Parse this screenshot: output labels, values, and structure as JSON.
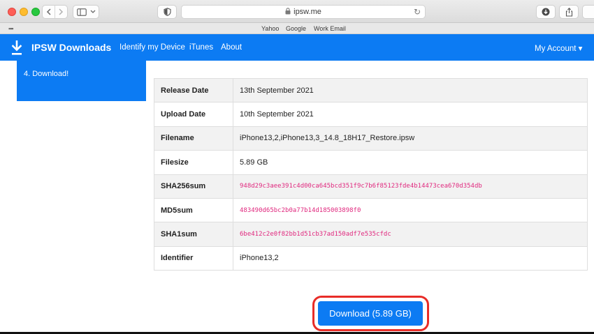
{
  "browser": {
    "address": "ipsw.me",
    "favorites": [
      "Yahoo",
      "Google",
      "Work Email"
    ]
  },
  "navbar": {
    "brand": "IPSW Downloads",
    "links": [
      "Identify my Device",
      "iTunes",
      "About"
    ],
    "account": "My Account ▾"
  },
  "step": {
    "label": "4. Download!"
  },
  "details": [
    {
      "key": "Release Date",
      "value": "13th September 2021"
    },
    {
      "key": "Upload Date",
      "value": "10th September 2021"
    },
    {
      "key": "Filename",
      "value": "iPhone13,2,iPhone13,3_14.8_18H17_Restore.ipsw"
    },
    {
      "key": "Filesize",
      "value": "5.89 GB"
    },
    {
      "key": "SHA256sum",
      "value": "948d29c3aee391c4d00ca645bcd351f9c7b6f85123fde4b14473cea670d354db"
    },
    {
      "key": "MD5sum",
      "value": "483490d65bc2b0a77b14d185003898f0"
    },
    {
      "key": "SHA1sum",
      "value": "6be412c2e0f82bb1d51cb37ad150adf7e535cfdc"
    },
    {
      "key": "Identifier",
      "value": "iPhone13,2"
    }
  ],
  "download_label": "Download (5.89 GB)",
  "colors": {
    "brand_blue": "#0c7bf3",
    "hash_pink": "#e0287e",
    "highlight_red": "#e82c28"
  }
}
